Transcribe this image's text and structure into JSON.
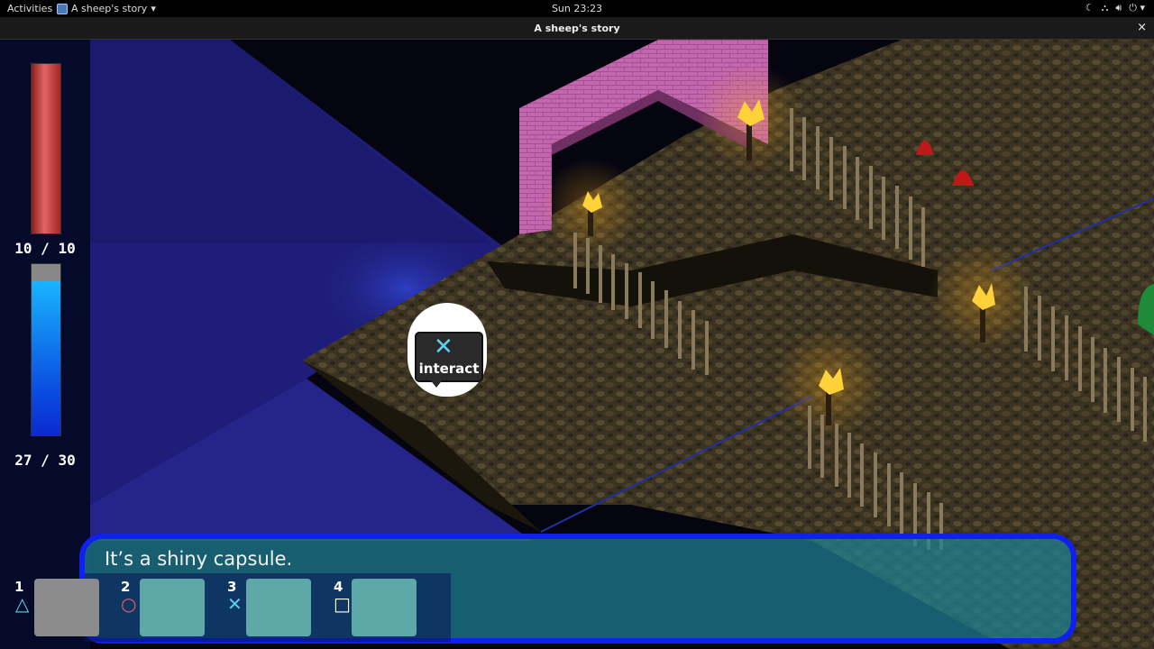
{
  "system_bar": {
    "activities": "Activities",
    "app_menu": "A sheep's story",
    "clock": "Sun 23:23",
    "tray_icons": [
      "night-light-icon",
      "network-icon",
      "volume-icon",
      "power-icon"
    ]
  },
  "window": {
    "title": "A sheep's story",
    "close_glyph": "×"
  },
  "hud": {
    "health": {
      "current": 10,
      "max": 10,
      "label": "10 / 10",
      "fill_fraction": 1.0,
      "color": "#d84545"
    },
    "mana": {
      "current": 27,
      "max": 30,
      "label": "27 / 30",
      "fill_fraction": 0.9,
      "color": "#1a7aff"
    }
  },
  "interact_prompt": {
    "button_glyph": "✕",
    "label": "interact"
  },
  "dialog": {
    "text": "It’s a shiny capsule."
  },
  "hotbar": {
    "slots": [
      {
        "number": "1",
        "symbol": "△",
        "symbol_name": "triangle-icon",
        "filled": true
      },
      {
        "number": "2",
        "symbol": "○",
        "symbol_name": "circle-icon",
        "filled": false
      },
      {
        "number": "3",
        "symbol": "✕",
        "symbol_name": "cross-icon",
        "filled": false
      },
      {
        "number": "4",
        "symbol": "□",
        "symbol_name": "square-icon",
        "filled": false
      }
    ]
  },
  "colors": {
    "dialog_border": "#1020f0",
    "wall": "#b0559a",
    "floor": "#3a3220",
    "torch_flame": "#ffd23a"
  }
}
